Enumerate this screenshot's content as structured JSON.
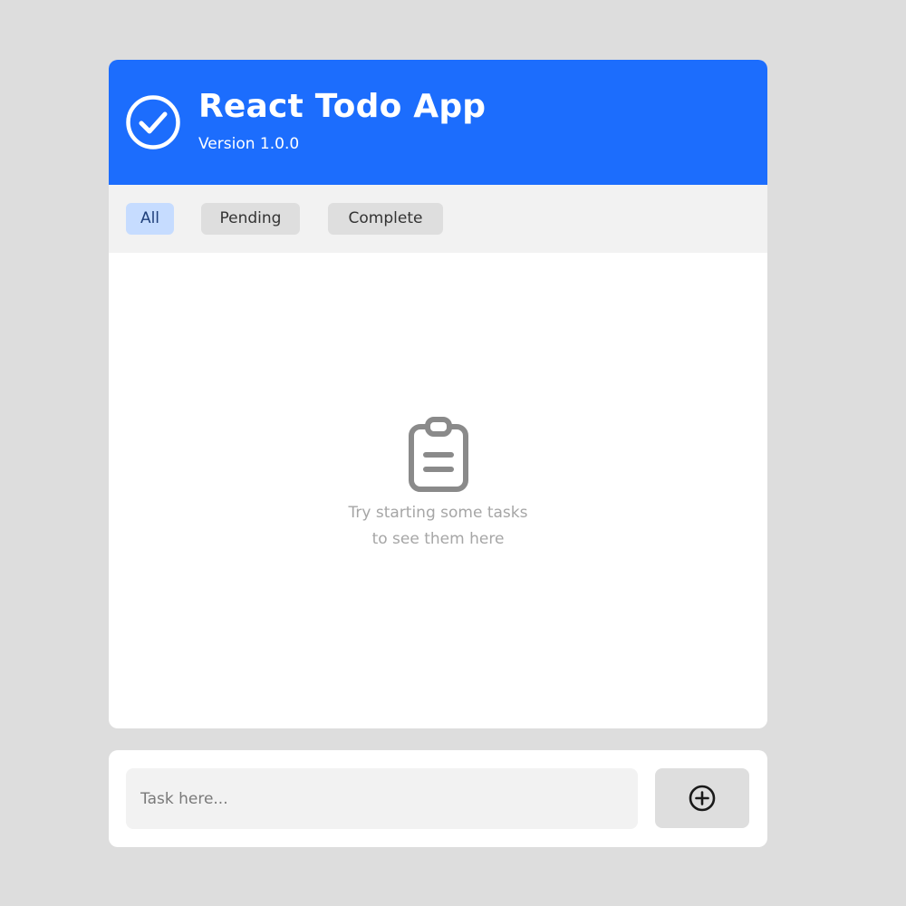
{
  "header": {
    "title": "React Todo App",
    "version": "Version 1.0.0",
    "icon": "check-circle-icon",
    "background_color": "#1c6dfd"
  },
  "filters": {
    "items": [
      {
        "label": "All",
        "active": true
      },
      {
        "label": "Pending",
        "active": false
      },
      {
        "label": "Complete",
        "active": false
      }
    ]
  },
  "empty_state": {
    "icon": "clipboard-icon",
    "line1": "Try starting some tasks",
    "line2": "to see them here"
  },
  "task_input": {
    "placeholder": "Task here...",
    "value": ""
  },
  "add_button": {
    "icon": "plus-circle-icon"
  },
  "colors": {
    "page_background": "#dddddd",
    "accent": "#1c6dfd",
    "active_filter_background": "#c6dcff"
  }
}
